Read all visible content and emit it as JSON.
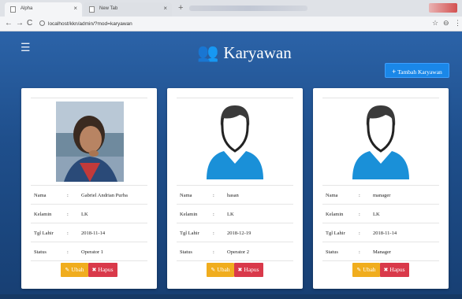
{
  "browser": {
    "tabs": [
      {
        "label": "Alpha"
      },
      {
        "label": "New Tab"
      }
    ],
    "url": "localhost/kkn/admin/?mod=karyawan"
  },
  "header": {
    "title": "Karyawan",
    "add_button": "Tambah Karyawan"
  },
  "field_labels": {
    "nama": "Nama",
    "kelamin": "Kelamin",
    "tgl_lahir": "Tgl Lahir",
    "status": "Status",
    "colon": ":"
  },
  "actions": {
    "edit": "Ubah",
    "delete": "Hapus"
  },
  "employees": [
    {
      "nama": "Gabriel Andrian Purba",
      "kelamin": "LK",
      "tgl_lahir": "2018-11-14",
      "status": "Operator 1",
      "photo": "photo"
    },
    {
      "nama": "hasan",
      "kelamin": "LK",
      "tgl_lahir": "2018-12-19",
      "status": "Operator 2",
      "photo": "default-avatar"
    },
    {
      "nama": "manager",
      "kelamin": "LK",
      "tgl_lahir": "2018-11-14",
      "status": "Manager",
      "photo": "default-avatar"
    }
  ],
  "colors": {
    "header_bg": "#2b63a8",
    "add_button": "#1a87e8",
    "edit_button": "#f0ad1e",
    "delete_button": "#d9394a",
    "avatar_blue": "#1a90d8"
  }
}
